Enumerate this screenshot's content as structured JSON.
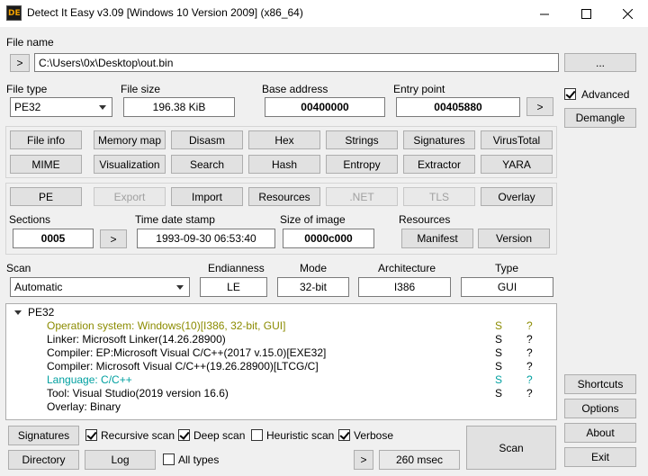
{
  "window": {
    "title": "Detect It Easy v3.09 [Windows 10 Version 2009] (x86_64)",
    "icon_text": "DE",
    "minimize_icon": "minimize-icon",
    "maximize_icon": "maximize-icon",
    "close_icon": "close-icon"
  },
  "file": {
    "label": "File name",
    "open_button": ">",
    "path": "C:\\Users\\0x\\Desktop\\out.bin",
    "browse_button": "..."
  },
  "info": {
    "file_type_label": "File type",
    "file_type_value": "PE32",
    "file_size_label": "File size",
    "file_size_value": "196.38 KiB",
    "base_address_label": "Base address",
    "base_address_value": "00400000",
    "entry_point_label": "Entry point",
    "entry_point_value": "00405880",
    "entry_point_button": ">"
  },
  "right_panel": {
    "advanced_label": "Advanced",
    "advanced_checked": true,
    "demangle": "Demangle",
    "shortcuts": "Shortcuts",
    "options": "Options",
    "about": "About",
    "exit": "Exit"
  },
  "tools_row1": [
    "File info",
    "Memory map",
    "Disasm",
    "Hex",
    "Strings",
    "Signatures",
    "VirusTotal"
  ],
  "tools_row2": [
    "MIME",
    "Visualization",
    "Search",
    "Hash",
    "Entropy",
    "Extractor",
    "YARA"
  ],
  "pe": {
    "pe": "PE",
    "export": "Export",
    "import": "Import",
    "resources": "Resources",
    "net": ".NET",
    "tls": "TLS",
    "overlay": "Overlay",
    "sections_label": "Sections",
    "sections_value": "0005",
    "sections_button": ">",
    "timestamp_label": "Time date stamp",
    "timestamp_value": "1993-09-30 06:53:40",
    "size_of_image_label": "Size of image",
    "size_of_image_value": "0000c000",
    "resources_label": "Resources",
    "manifest": "Manifest",
    "version": "Version"
  },
  "scan": {
    "scan_label": "Scan",
    "scan_mode": "Automatic",
    "endianness_label": "Endianness",
    "endianness_value": "LE",
    "mode_label": "Mode",
    "mode_value": "32-bit",
    "architecture_label": "Architecture",
    "architecture_value": "I386",
    "type_label": "Type",
    "type_value": "GUI"
  },
  "results": {
    "root": "PE32",
    "rows": [
      {
        "text": "Operation system: Windows(10)[I386, 32-bit, GUI]",
        "s": "S",
        "q": "?",
        "color": "#8b8b00"
      },
      {
        "text": "Linker: Microsoft Linker(14.26.28900)",
        "s": "S",
        "q": "?",
        "color": "#000000"
      },
      {
        "text": "Compiler: EP:Microsoft Visual C/C++(2017 v.15.0)[EXE32]",
        "s": "S",
        "q": "?",
        "color": "#000000"
      },
      {
        "text": "Compiler: Microsoft Visual C/C++(19.26.28900)[LTCG/C]",
        "s": "S",
        "q": "?",
        "color": "#000000"
      },
      {
        "text": "Language: C/C++",
        "s": "S",
        "q": "?",
        "color": "#00a0a0"
      },
      {
        "text": "Tool: Visual Studio(2019 version 16.6)",
        "s": "S",
        "q": "?",
        "color": "#000000"
      },
      {
        "text": "Overlay: Binary",
        "s": "",
        "q": "",
        "color": "#000000"
      }
    ]
  },
  "bottom": {
    "signatures": "Signatures",
    "directory": "Directory",
    "log": "Log",
    "recursive_scan": "Recursive scan",
    "recursive_checked": true,
    "deep_scan": "Deep scan",
    "deep_checked": true,
    "heuristic_scan": "Heuristic scan",
    "heuristic_checked": false,
    "verbose": "Verbose",
    "verbose_checked": true,
    "all_types": "All types",
    "all_types_checked": false,
    "time_button": ">",
    "time_value": "260 msec",
    "scan_button": "Scan"
  }
}
